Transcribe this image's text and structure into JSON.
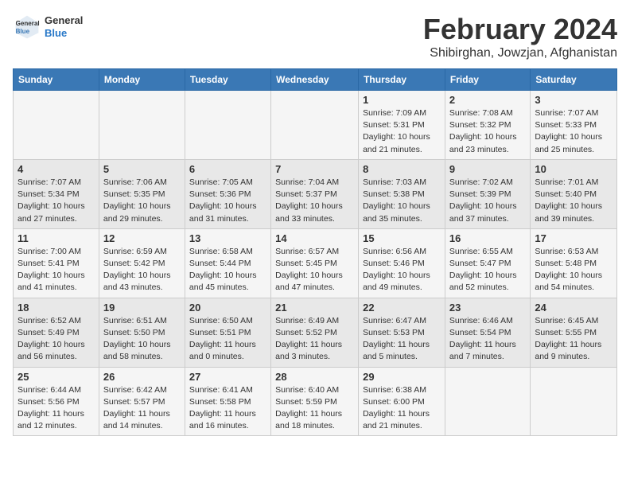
{
  "header": {
    "logo": {
      "general": "General",
      "blue": "Blue"
    },
    "title": "February 2024",
    "subtitle": "Shibirghan, Jowzjan, Afghanistan"
  },
  "days_of_week": [
    "Sunday",
    "Monday",
    "Tuesday",
    "Wednesday",
    "Thursday",
    "Friday",
    "Saturday"
  ],
  "weeks": [
    [
      {
        "day": "",
        "sunrise": "",
        "sunset": "",
        "daylight": ""
      },
      {
        "day": "",
        "sunrise": "",
        "sunset": "",
        "daylight": ""
      },
      {
        "day": "",
        "sunrise": "",
        "sunset": "",
        "daylight": ""
      },
      {
        "day": "",
        "sunrise": "",
        "sunset": "",
        "daylight": ""
      },
      {
        "day": "1",
        "sunrise": "Sunrise: 7:09 AM",
        "sunset": "Sunset: 5:31 PM",
        "daylight": "Daylight: 10 hours and 21 minutes."
      },
      {
        "day": "2",
        "sunrise": "Sunrise: 7:08 AM",
        "sunset": "Sunset: 5:32 PM",
        "daylight": "Daylight: 10 hours and 23 minutes."
      },
      {
        "day": "3",
        "sunrise": "Sunrise: 7:07 AM",
        "sunset": "Sunset: 5:33 PM",
        "daylight": "Daylight: 10 hours and 25 minutes."
      }
    ],
    [
      {
        "day": "4",
        "sunrise": "Sunrise: 7:07 AM",
        "sunset": "Sunset: 5:34 PM",
        "daylight": "Daylight: 10 hours and 27 minutes."
      },
      {
        "day": "5",
        "sunrise": "Sunrise: 7:06 AM",
        "sunset": "Sunset: 5:35 PM",
        "daylight": "Daylight: 10 hours and 29 minutes."
      },
      {
        "day": "6",
        "sunrise": "Sunrise: 7:05 AM",
        "sunset": "Sunset: 5:36 PM",
        "daylight": "Daylight: 10 hours and 31 minutes."
      },
      {
        "day": "7",
        "sunrise": "Sunrise: 7:04 AM",
        "sunset": "Sunset: 5:37 PM",
        "daylight": "Daylight: 10 hours and 33 minutes."
      },
      {
        "day": "8",
        "sunrise": "Sunrise: 7:03 AM",
        "sunset": "Sunset: 5:38 PM",
        "daylight": "Daylight: 10 hours and 35 minutes."
      },
      {
        "day": "9",
        "sunrise": "Sunrise: 7:02 AM",
        "sunset": "Sunset: 5:39 PM",
        "daylight": "Daylight: 10 hours and 37 minutes."
      },
      {
        "day": "10",
        "sunrise": "Sunrise: 7:01 AM",
        "sunset": "Sunset: 5:40 PM",
        "daylight": "Daylight: 10 hours and 39 minutes."
      }
    ],
    [
      {
        "day": "11",
        "sunrise": "Sunrise: 7:00 AM",
        "sunset": "Sunset: 5:41 PM",
        "daylight": "Daylight: 10 hours and 41 minutes."
      },
      {
        "day": "12",
        "sunrise": "Sunrise: 6:59 AM",
        "sunset": "Sunset: 5:42 PM",
        "daylight": "Daylight: 10 hours and 43 minutes."
      },
      {
        "day": "13",
        "sunrise": "Sunrise: 6:58 AM",
        "sunset": "Sunset: 5:44 PM",
        "daylight": "Daylight: 10 hours and 45 minutes."
      },
      {
        "day": "14",
        "sunrise": "Sunrise: 6:57 AM",
        "sunset": "Sunset: 5:45 PM",
        "daylight": "Daylight: 10 hours and 47 minutes."
      },
      {
        "day": "15",
        "sunrise": "Sunrise: 6:56 AM",
        "sunset": "Sunset: 5:46 PM",
        "daylight": "Daylight: 10 hours and 49 minutes."
      },
      {
        "day": "16",
        "sunrise": "Sunrise: 6:55 AM",
        "sunset": "Sunset: 5:47 PM",
        "daylight": "Daylight: 10 hours and 52 minutes."
      },
      {
        "day": "17",
        "sunrise": "Sunrise: 6:53 AM",
        "sunset": "Sunset: 5:48 PM",
        "daylight": "Daylight: 10 hours and 54 minutes."
      }
    ],
    [
      {
        "day": "18",
        "sunrise": "Sunrise: 6:52 AM",
        "sunset": "Sunset: 5:49 PM",
        "daylight": "Daylight: 10 hours and 56 minutes."
      },
      {
        "day": "19",
        "sunrise": "Sunrise: 6:51 AM",
        "sunset": "Sunset: 5:50 PM",
        "daylight": "Daylight: 10 hours and 58 minutes."
      },
      {
        "day": "20",
        "sunrise": "Sunrise: 6:50 AM",
        "sunset": "Sunset: 5:51 PM",
        "daylight": "Daylight: 11 hours and 0 minutes."
      },
      {
        "day": "21",
        "sunrise": "Sunrise: 6:49 AM",
        "sunset": "Sunset: 5:52 PM",
        "daylight": "Daylight: 11 hours and 3 minutes."
      },
      {
        "day": "22",
        "sunrise": "Sunrise: 6:47 AM",
        "sunset": "Sunset: 5:53 PM",
        "daylight": "Daylight: 11 hours and 5 minutes."
      },
      {
        "day": "23",
        "sunrise": "Sunrise: 6:46 AM",
        "sunset": "Sunset: 5:54 PM",
        "daylight": "Daylight: 11 hours and 7 minutes."
      },
      {
        "day": "24",
        "sunrise": "Sunrise: 6:45 AM",
        "sunset": "Sunset: 5:55 PM",
        "daylight": "Daylight: 11 hours and 9 minutes."
      }
    ],
    [
      {
        "day": "25",
        "sunrise": "Sunrise: 6:44 AM",
        "sunset": "Sunset: 5:56 PM",
        "daylight": "Daylight: 11 hours and 12 minutes."
      },
      {
        "day": "26",
        "sunrise": "Sunrise: 6:42 AM",
        "sunset": "Sunset: 5:57 PM",
        "daylight": "Daylight: 11 hours and 14 minutes."
      },
      {
        "day": "27",
        "sunrise": "Sunrise: 6:41 AM",
        "sunset": "Sunset: 5:58 PM",
        "daylight": "Daylight: 11 hours and 16 minutes."
      },
      {
        "day": "28",
        "sunrise": "Sunrise: 6:40 AM",
        "sunset": "Sunset: 5:59 PM",
        "daylight": "Daylight: 11 hours and 18 minutes."
      },
      {
        "day": "29",
        "sunrise": "Sunrise: 6:38 AM",
        "sunset": "Sunset: 6:00 PM",
        "daylight": "Daylight: 11 hours and 21 minutes."
      },
      {
        "day": "",
        "sunrise": "",
        "sunset": "",
        "daylight": ""
      },
      {
        "day": "",
        "sunrise": "",
        "sunset": "",
        "daylight": ""
      }
    ]
  ]
}
